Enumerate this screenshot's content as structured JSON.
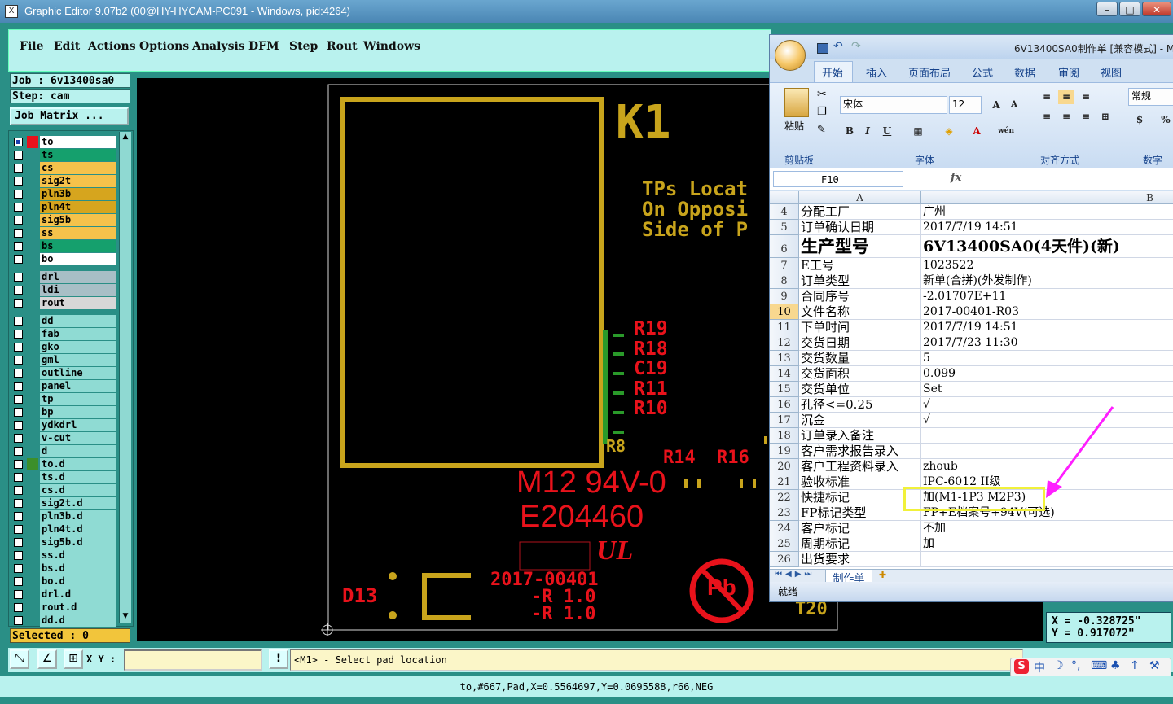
{
  "window": {
    "title": "Graphic Editor 9.07b2 (00@HY-HYCAM-PC091 - Windows, pid:4264)",
    "app_icon": "X",
    "minimize_label": "–",
    "restore_label": "□",
    "close_label": "✕"
  },
  "menu": [
    "File",
    "Edit",
    "Actions",
    "Options",
    "Analysis",
    "DFM",
    "Step",
    "Rout",
    "Windows"
  ],
  "job": {
    "job_label": "Job : 6v13400sa0",
    "step_label": "Step: cam",
    "matrix_button": "Job Matrix ..."
  },
  "layers": [
    {
      "name": "to",
      "color": "#ffffff",
      "swatch": "#e8121b",
      "active": true
    },
    {
      "name": "ts",
      "color": "#15a06d"
    },
    {
      "name": "cs",
      "color": "#f5c24b"
    },
    {
      "name": "sig2t",
      "color": "#f5c24b"
    },
    {
      "name": "pln3b",
      "color": "#d6a51e"
    },
    {
      "name": "pln4t",
      "color": "#d6a51e"
    },
    {
      "name": "sig5b",
      "color": "#f5c24b"
    },
    {
      "name": "ss",
      "color": "#f5c24b"
    },
    {
      "name": "bs",
      "color": "#15a06d"
    },
    {
      "name": "bo",
      "color": "#ffffff"
    },
    {
      "name": "drl",
      "color": "#a8bfc6"
    },
    {
      "name": "ldi",
      "color": "#a8bfc6"
    },
    {
      "name": "rout",
      "color": "#d7d7d7"
    },
    {
      "name": "dd",
      "color": "#8fdbd3"
    },
    {
      "name": "fab",
      "color": "#8fdbd3"
    },
    {
      "name": "gko",
      "color": "#8fdbd3"
    },
    {
      "name": "gml",
      "color": "#8fdbd3"
    },
    {
      "name": "outline",
      "color": "#8fdbd3"
    },
    {
      "name": "panel",
      "color": "#8fdbd3"
    },
    {
      "name": "tp",
      "color": "#8fdbd3"
    },
    {
      "name": "bp",
      "color": "#8fdbd3"
    },
    {
      "name": "ydkdrl",
      "color": "#8fdbd3"
    },
    {
      "name": "v-cut",
      "color": "#8fdbd3"
    },
    {
      "name": "d",
      "color": "#8fdbd3"
    },
    {
      "name": "to.d",
      "color": "#8fdbd3",
      "swatch": "#3c8f2a"
    },
    {
      "name": "ts.d",
      "color": "#8fdbd3"
    },
    {
      "name": "cs.d",
      "color": "#8fdbd3"
    },
    {
      "name": "sig2t.d",
      "color": "#8fdbd3"
    },
    {
      "name": "pln3b.d",
      "color": "#8fdbd3"
    },
    {
      "name": "pln4t.d",
      "color": "#8fdbd3"
    },
    {
      "name": "sig5b.d",
      "color": "#8fdbd3"
    },
    {
      "name": "ss.d",
      "color": "#8fdbd3"
    },
    {
      "name": "bs.d",
      "color": "#8fdbd3"
    },
    {
      "name": "bo.d",
      "color": "#8fdbd3"
    },
    {
      "name": "drl.d",
      "color": "#8fdbd3"
    },
    {
      "name": "rout.d",
      "color": "#8fdbd3"
    },
    {
      "name": "dd.d",
      "color": "#8fdbd3"
    }
  ],
  "selected_label": "Selected : 0",
  "canvas": {
    "k1": "K1",
    "tps_lines": [
      "TPs Locat",
      "On Opposi",
      "Side of P"
    ],
    "refdes_stack": [
      "R19",
      "R18",
      "C19",
      "R11",
      "R10"
    ],
    "r8": "R8",
    "r14": "R14",
    "r16": "R16",
    "d13": "D13",
    "t20": "T20",
    "marking1": "M12 94V-0",
    "marking2": "E204460",
    "ul_mark": "UL",
    "pb_mark": "Pb",
    "date_line": "2017-00401",
    "rev_line1": "-R 1.0",
    "rev_line2": "-R 1.0"
  },
  "coords": {
    "x": "X = -0.328725\"",
    "y": "Y = 0.917072\""
  },
  "command": {
    "xy_label": "X Y :",
    "xy_value": "",
    "warn_icon": "!",
    "prompt": "<M1> - Select pad location"
  },
  "status_line": "to,#667,Pad,X=0.5564697,Y=0.0695588,r66,NEG",
  "ime": {
    "logo": "S",
    "lang": "中",
    "items": [
      "☽",
      "°,",
      "⌨",
      "♣",
      "↑",
      "⚒"
    ]
  },
  "excel": {
    "title": "6V13400SA0制作单 [兼容模式] - M",
    "tabs": [
      "开始",
      "插入",
      "页面布局",
      "公式",
      "数据",
      "审阅",
      "视图"
    ],
    "font_name": "宋体",
    "font_size": "12",
    "number_format": "常规",
    "groups": [
      "剪贴板",
      "字体",
      "对齐方式",
      "数字"
    ],
    "paste_label": "粘贴",
    "name_box": "F10",
    "fx": "fx",
    "col_a": "A",
    "col_b": "B",
    "rows": [
      {
        "num": "4",
        "a": "分配工厂",
        "b": "广州"
      },
      {
        "num": "5",
        "a": "订单确认日期",
        "b": "2017/7/19 14:51"
      },
      {
        "num": "6",
        "a": "生产型号",
        "b": "6V13400SA0(4天件)(新)",
        "big": true
      },
      {
        "num": "7",
        "a": "E工号",
        "b": "1023522"
      },
      {
        "num": "8",
        "a": "订单类型",
        "b": "新单(合拼)(外发制作)"
      },
      {
        "num": "9",
        "a": "合同序号",
        "b": "-2.01707E+11"
      },
      {
        "num": "10",
        "a": "文件名称",
        "b": "2017-00401-R03",
        "sel": true
      },
      {
        "num": "11",
        "a": "下单时间",
        "b": "2017/7/19 14:51"
      },
      {
        "num": "12",
        "a": "交货日期",
        "b": "2017/7/23 11:30"
      },
      {
        "num": "13",
        "a": "交货数量",
        "b": "5"
      },
      {
        "num": "14",
        "a": "交货面积",
        "b": "0.099"
      },
      {
        "num": "15",
        "a": "交货单位",
        "b": "Set"
      },
      {
        "num": "16",
        "a": "孔径<=0.25",
        "b": "√"
      },
      {
        "num": "17",
        "a": "沉金",
        "b": "√"
      },
      {
        "num": "18",
        "a": "订单录入备注",
        "b": ""
      },
      {
        "num": "19",
        "a": "客户需求报告录入",
        "b": ""
      },
      {
        "num": "20",
        "a": "客户工程资料录入",
        "b": "zhoub"
      },
      {
        "num": "21",
        "a": "验收标准",
        "b": "IPC-6012 II级"
      },
      {
        "num": "22",
        "a": "快捷标记",
        "b": "加(M1-1P3 M2P3)"
      },
      {
        "num": "23",
        "a": "FP标记类型",
        "b": "FP+E档案号+94V(可选)"
      },
      {
        "num": "24",
        "a": "客户标记",
        "b": "不加"
      },
      {
        "num": "25",
        "a": "周期标记",
        "b": "加"
      },
      {
        "num": "26",
        "a": "出货要求",
        "b": ""
      }
    ],
    "sheet_tab": "制作单",
    "status": "就绪"
  },
  "colors": {
    "silkscreen": "#c8a41c",
    "copper_red": "#e8121b",
    "pad_green": "#2a9a2a",
    "arrow": "#ff1eff",
    "highlight": "#f1f13a"
  }
}
